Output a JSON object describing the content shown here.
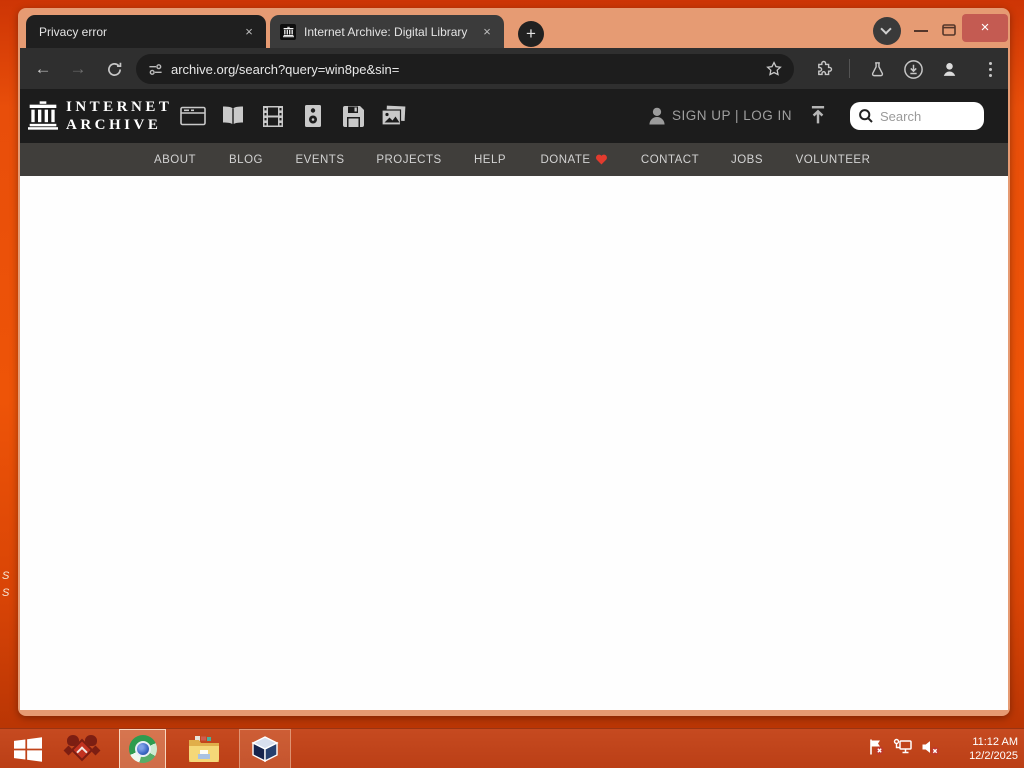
{
  "browser": {
    "tabs": [
      {
        "title": "Privacy error"
      },
      {
        "title": "Internet Archive: Digital Library"
      }
    ],
    "url": "archive.org/search?query=win8pe&sin="
  },
  "archive": {
    "logo_line1": "INTERNET",
    "logo_line2": "ARCHIVE",
    "auth": "SIGN UP | LOG IN",
    "search_placeholder": "Search",
    "media_types": [
      "web",
      "texts",
      "video",
      "audio",
      "software",
      "images"
    ],
    "nav": {
      "items": [
        "ABOUT",
        "BLOG",
        "EVENTS",
        "PROJECTS",
        "HELP",
        "DONATE",
        "CONTACT",
        "JOBS",
        "VOLUNTEER"
      ]
    }
  },
  "taskbar": {
    "clock": {
      "time": "11:12 AM",
      "date": "12/2/2025"
    }
  },
  "desktop": {
    "fragments": [
      "S",
      "S"
    ]
  },
  "icons": {
    "close_glyph": "×",
    "plus_glyph": "+",
    "back_glyph": "←",
    "forward_glyph": "→"
  },
  "colors": {
    "desktop_orange": "#e84e0a",
    "window_frame": "#e69b73",
    "close_button": "#c45b52",
    "dark_header": "#1c1c1c",
    "nav_bar": "#403e3b",
    "donate_heart": "#e23b2e",
    "taskbar": "#c04318"
  }
}
